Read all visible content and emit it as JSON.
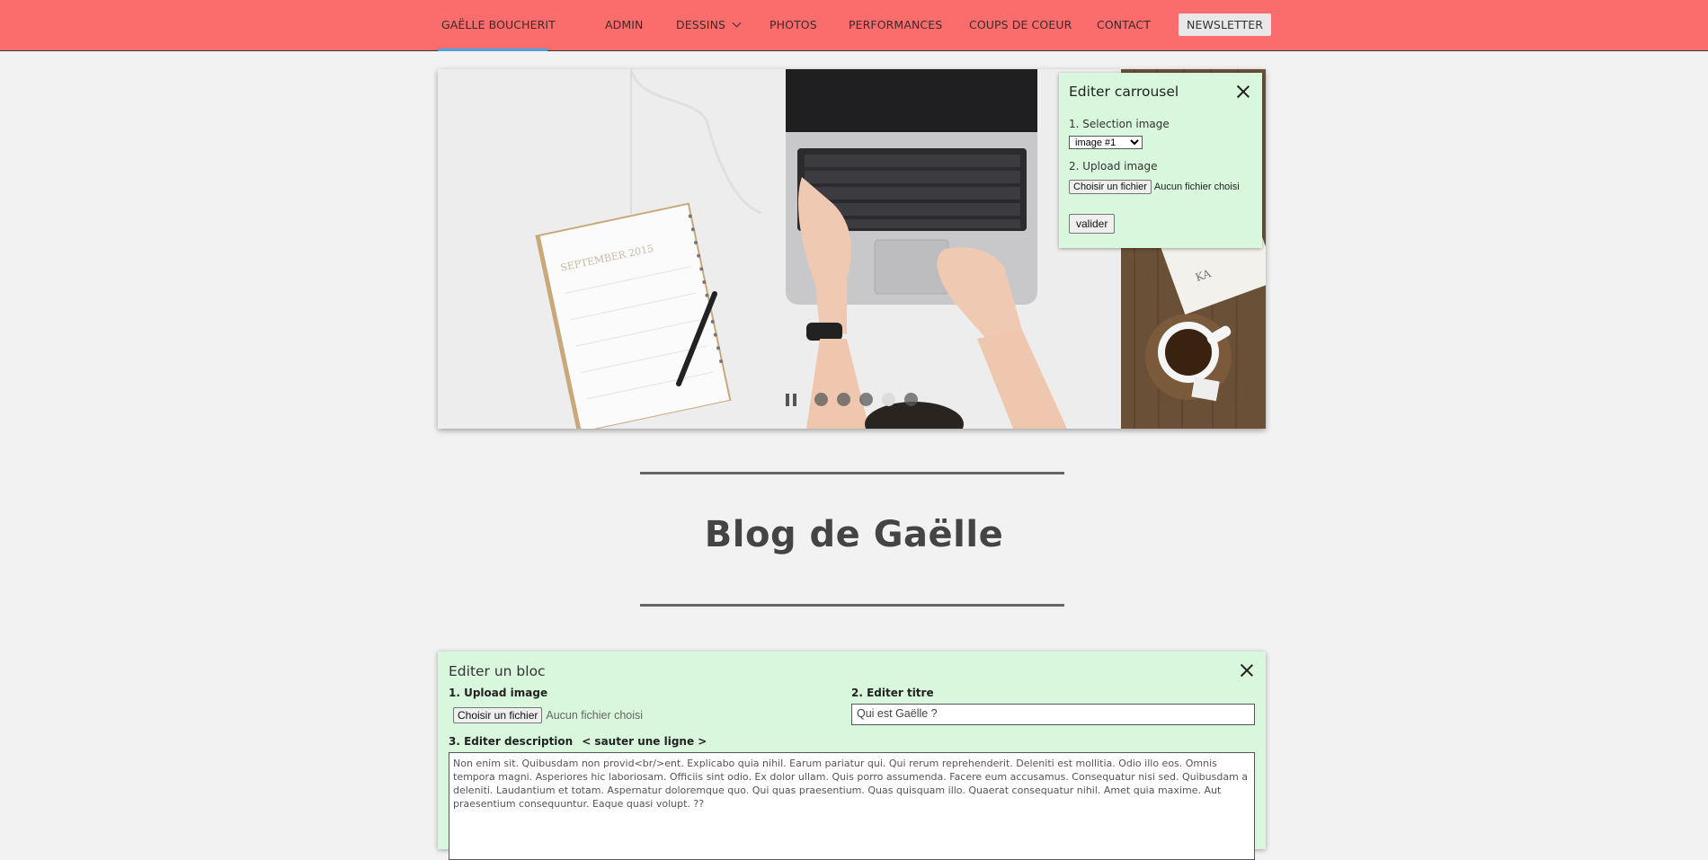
{
  "nav": {
    "brand": "GAËLLE BOUCHERIT",
    "items": [
      "ADMIN",
      "DESSINS",
      "PHOTOS",
      "PERFORMANCES",
      "COUPS DE COEUR",
      "CONTACT"
    ],
    "newsletter": "NEWSLETTER",
    "colors": {
      "background": "#fb6d6d",
      "active_underline": "#4aa3e0"
    }
  },
  "carousel": {
    "slide_count": 5,
    "active_slide": 4,
    "icons": {
      "pause": "pause-icon"
    }
  },
  "carousel_editor": {
    "title": "Editer carrousel",
    "step1_label": "1. Selection image",
    "select_value": "image #1",
    "step2_label": "2. Upload image",
    "file_button": "Choisir un fichier",
    "file_status": "Aucun fichier choisi",
    "submit": "valider",
    "background": "#d9f7dc"
  },
  "blog": {
    "title": "Blog de Gaëlle"
  },
  "bloc_editor": {
    "title": "Editer un bloc",
    "upload_label": "1. Upload image",
    "file_button": "Choisir un fichier",
    "file_status": "Aucun fichier choisi",
    "title_label": "2. Editer titre",
    "title_value": "Qui est Gaëlle ?",
    "description_label": "3. Editer description",
    "line_break_hint": "< sauter une ligne >",
    "description_value": "Non enim sit. Quibusdam non provid<br/>ent. Explicabo quia nihil. Earum pariatur qui. Qui rerum reprehenderit. Deleniti est mollitia. Odio illo eos. Omnis tempora magni. Asperiores hic laboriosam. Officiis sint odio. Ex dolor ullam. Quis porro assumenda. Facere eum accusamus. Consequatur nisi sed. Quibusdam a deleniti. Laudantium et totam. Aspernatur doloremque quo. Qui quas praesentium. Quas quisquam illo. Quaerat consequatur nihil. Amet quia maxime. Aut praesentium consequuntur. Eaque quasi volupt. ??"
  }
}
